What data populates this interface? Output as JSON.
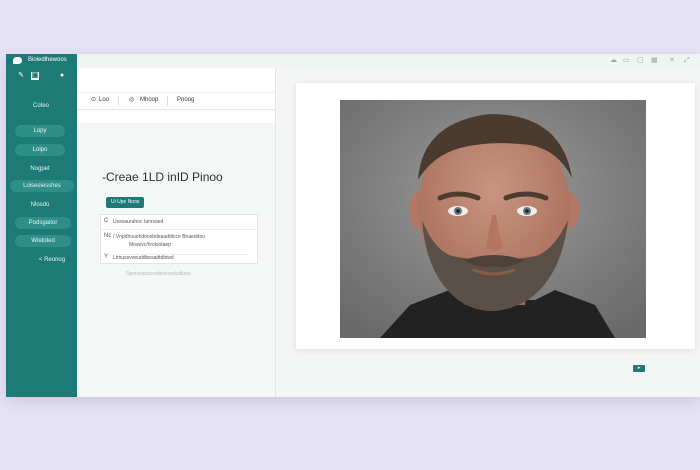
{
  "app": {
    "title": "Bioiedlhewoos"
  },
  "sidebar": {
    "items": [
      {
        "label": "Coteo",
        "active": false
      },
      {
        "label": "Lopy",
        "active": true
      },
      {
        "label": "Lolpo",
        "active": true
      },
      {
        "label": "Nogpet",
        "active": false
      },
      {
        "label": "Loisesiesshes",
        "active": true
      },
      {
        "label": "Nlosdo",
        "active": false
      },
      {
        "label": "Podsgaitor",
        "active": true
      },
      {
        "label": "Wodoled",
        "active": true
      },
      {
        "label": "Reonog",
        "active": false,
        "prefix": "<"
      }
    ]
  },
  "toolbar": {
    "item1": "Loo",
    "item2": "Mhoop",
    "item3": "Pnoog"
  },
  "content": {
    "heading": "-Creae 1LD inID Pinoo",
    "button": "Ui Upe Noos",
    "rows": [
      {
        "icon": "C",
        "text": "Ussoaurahoc Ianrsaed"
      },
      {
        "icon": "Nc",
        "text": "/ Vnpdhouohdoosbdeaaddtcce Bnaeddoo"
      },
      {
        "icon": "",
        "text": "Mosevc/hrolsntaep"
      },
      {
        "icon": "Y",
        "text": "Ltmussvoeuddbesadtdbiwd"
      }
    ],
    "faint": "Spmousoacrodeshosdudluou"
  },
  "colors": {
    "accent": "#1d7a76",
    "background": "#e6e3f7"
  },
  "icons": {
    "window_controls": [
      "minimize-icon",
      "restore-icon",
      "maximize-icon",
      "close-icon"
    ]
  }
}
